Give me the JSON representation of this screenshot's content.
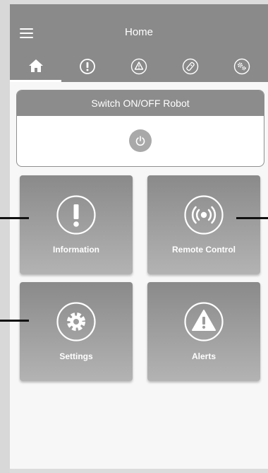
{
  "header": {
    "title": "Home",
    "tabs": [
      {
        "name": "home",
        "icon": "home-icon",
        "active": true
      },
      {
        "name": "information",
        "icon": "exclamation-circle-icon",
        "active": false
      },
      {
        "name": "alerts",
        "icon": "warning-triangle-icon",
        "active": false
      },
      {
        "name": "remote",
        "icon": "remote-icon",
        "active": false
      },
      {
        "name": "settings",
        "icon": "gears-icon",
        "active": false
      }
    ]
  },
  "switch_panel": {
    "title": "Switch ON/OFF Robot",
    "button_icon": "power-icon"
  },
  "tiles": [
    {
      "label": "Information",
      "icon": "exclamation-circle-icon"
    },
    {
      "label": "Remote Control",
      "icon": "signal-broadcast-icon"
    },
    {
      "label": "Settings",
      "icon": "gear-icon"
    },
    {
      "label": "Alerts",
      "icon": "warning-triangle-icon"
    }
  ],
  "colors": {
    "header_bg": "#8a8a8a",
    "tile_top": "#8a8a8a",
    "tile_bottom": "#b3b3b3",
    "page_bg": "#f7f7f7"
  }
}
